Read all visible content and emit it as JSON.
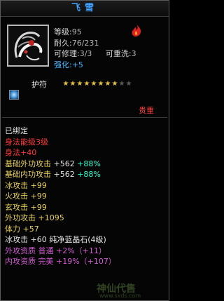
{
  "title": "飞雪",
  "stats": [
    {
      "label": "等级:",
      "value": "95",
      "color": "#b4b4b4"
    },
    {
      "label": "耐久:",
      "value": "76/231",
      "color": "#b4b4b4"
    },
    {
      "label": "可修理:",
      "value": "3/3",
      "color": "#b4b4b4",
      "extra_label": "可重洗:",
      "extra_value": "3"
    },
    {
      "label": "强化:",
      "value": "+5",
      "color": "#46b4ff"
    }
  ],
  "charm_label": "护符",
  "stars": {
    "filled": 8,
    "total": 10
  },
  "grade": "贵重",
  "attributes": [
    {
      "text": "已绑定",
      "color": "#e6e6e6"
    },
    {
      "text": "身法能级3级",
      "color": "#ff3838"
    },
    {
      "text": "身法+40",
      "color": "#ff3838"
    },
    {
      "label": "基础外功攻击",
      "value": "+562",
      "pct": "+88%",
      "color": "#e8d25a"
    },
    {
      "label": "基础内功攻击",
      "value": "+562",
      "pct": "+88%",
      "color": "#e8d25a"
    },
    {
      "label": "冰攻击",
      "value": "+99",
      "color": "#e8d25a"
    },
    {
      "label": "火攻击",
      "value": "+99",
      "color": "#e8d25a"
    },
    {
      "label": "玄攻击",
      "value": "+99",
      "color": "#e8d25a"
    },
    {
      "label": "外功攻击",
      "value": "+1095",
      "color": "#e8d25a"
    },
    {
      "label": "体力",
      "value": "+57",
      "color": "#e8d25a"
    },
    {
      "label": "冰攻击",
      "value": "+60",
      "extra": "纯净蓝晶石(4级)",
      "color": "#e6e6e6"
    },
    {
      "label": "外攻资质",
      "value": "普通",
      "extra": "+2%（+11）",
      "color": "#d25ad2"
    },
    {
      "label": "内攻资质",
      "value": "完美",
      "extra": "+19%（+107）",
      "color": "#d25ad2"
    }
  ],
  "watermark": "神仙代售",
  "watermark_url": "www.sxds.com"
}
